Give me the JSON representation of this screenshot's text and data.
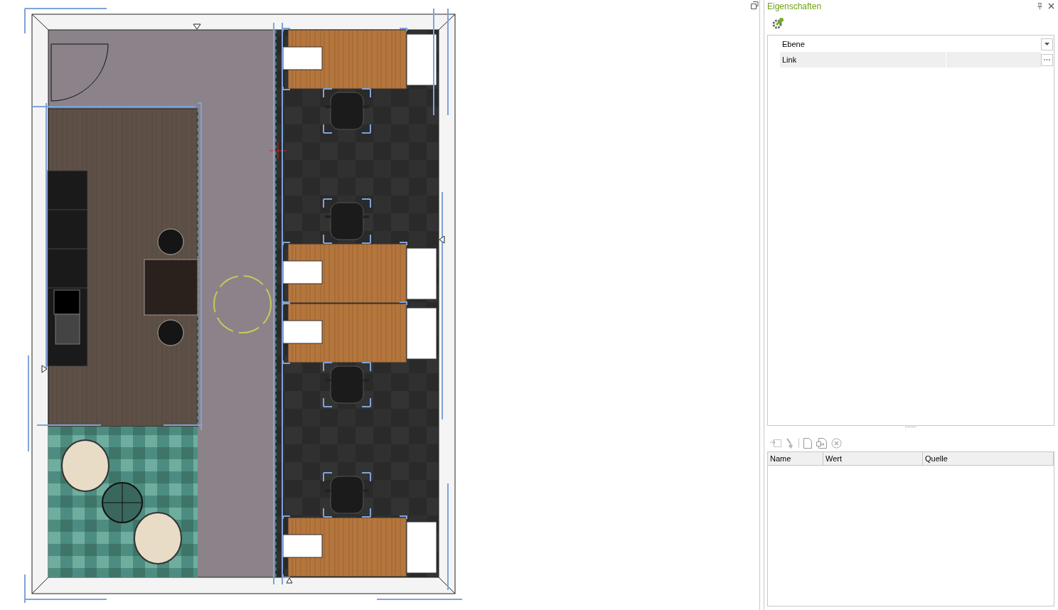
{
  "panel": {
    "title": "Eigenschaften"
  },
  "properties": [
    {
      "label": "Ebene",
      "kind": "dropdown",
      "selected": false
    },
    {
      "label": "Link",
      "kind": "ellipsis",
      "selected": true
    }
  ],
  "table": {
    "columns": [
      "Name",
      "Wert",
      "Quelle"
    ]
  }
}
